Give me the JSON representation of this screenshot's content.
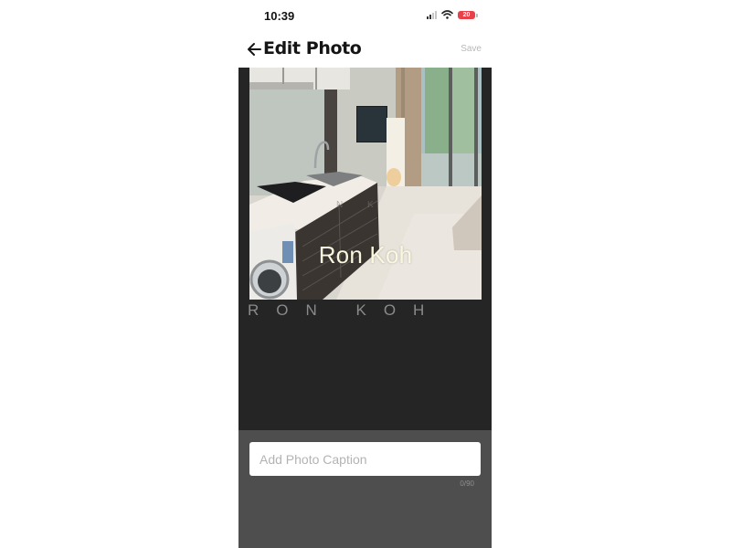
{
  "status_bar": {
    "time": "10:39",
    "battery": "20"
  },
  "header": {
    "title": "Edit Photo",
    "save_label": "Save"
  },
  "photo": {
    "overlay_text": "Ron Koh",
    "watermark_small": "N K",
    "watermark": "RON KOH"
  },
  "caption": {
    "placeholder": "Add Photo Caption",
    "value": "",
    "char_count": "0/90"
  },
  "colors": {
    "editor_bg": "#252525",
    "caption_bg": "#4e4e4e",
    "battery": "#e9414a",
    "overlay_text": "#fbf7df"
  }
}
